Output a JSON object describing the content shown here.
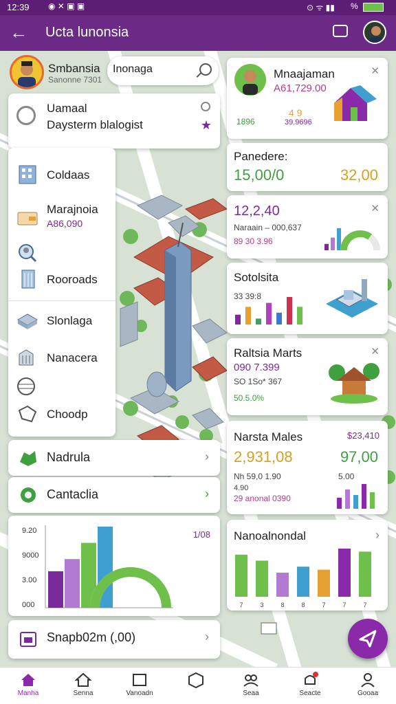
{
  "status_bar": {
    "time": "12:39",
    "battery": "%"
  },
  "app_bar": {
    "title": "Ucta lunonsia"
  },
  "profile": {
    "name": "Smbansia",
    "subtitle": "Sanonne 7301"
  },
  "search": {
    "value": "Inonaga"
  },
  "menu_card": {
    "title": "Uamaal",
    "subtitle": "Daysterm blalogist"
  },
  "list": [
    {
      "label": "Coldaas",
      "icon": "building-icon"
    },
    {
      "label": "Marajnoia",
      "value": "A86,090",
      "icon": "wallet-icon"
    },
    {
      "label": "",
      "icon": "search-person-icon"
    },
    {
      "label": "Rooroads",
      "icon": "tower-icon"
    },
    {
      "label": "Slonlaga",
      "icon": "city-icon"
    },
    {
      "label": "Nanacera",
      "icon": "factory-icon"
    },
    {
      "label": "",
      "icon": "globe-icon"
    },
    {
      "label": "Choodp",
      "icon": "tag-icon"
    }
  ],
  "rows": [
    {
      "label": "Nadrula",
      "icon": "map-icon"
    },
    {
      "label": "Cantaclia",
      "icon": "leaf-icon"
    }
  ],
  "left_chart": {
    "y_ticks": [
      "9.20",
      "9000",
      "3.00",
      "000"
    ],
    "corner_label": "1/08",
    "chart_data": {
      "type": "bar",
      "y_ticks": [
        "9.20",
        "9000",
        "3.00",
        "000"
      ],
      "values": [
        45,
        60,
        80,
        100
      ],
      "colors": [
        "#7a2a9a",
        "#b27ad0",
        "#6fc04a",
        "#3fa0d0"
      ],
      "gauge": 0.5,
      "gauge_color": "#6fc04a"
    }
  },
  "bottom_row": {
    "label": "Snapb02m (,00)"
  },
  "right_cards": [
    {
      "title": "Mnaajaman",
      "value": "A61,729.00",
      "stat_a": "1896",
      "stat_b": "4 9",
      "stat_c": "39.9696"
    },
    {
      "title": "Panedere:",
      "value_a": "15,00/0",
      "value_b": "32,00"
    },
    {
      "title": "12,2,40",
      "line1": "Naraain – 000,637",
      "line2": "89 30 3.96",
      "chart_data": {
        "type": "bar",
        "values": [
          20,
          40,
          70
        ],
        "gauge": 0.7
      }
    },
    {
      "title": "Sotolsita",
      "value": "33 39:8",
      "chart_data": {
        "type": "bar",
        "values": [
          25,
          45,
          15,
          55,
          30,
          70,
          45
        ],
        "colors": [
          "#7a2a9a",
          "#e8a030",
          "#3fa060",
          "#b040c0",
          "#3a7ad0",
          "#d03050",
          "#6fc04a"
        ]
      }
    },
    {
      "title": "Raltsia Marts",
      "value": "090 7.399",
      "line1": "SO 1So* 367",
      "line2": "50.5.0%"
    },
    {
      "title": "Narsta Males",
      "badge": "$23,410",
      "value_a": "2,931,08",
      "value_b": "97,00",
      "line1": "Nh 59,0 1.90",
      "line2": "4.90",
      "line3": "29 anonal 0390",
      "stat": "5.00",
      "chart_data": {
        "type": "bar",
        "values": [
          40,
          70,
          50,
          90,
          60
        ]
      }
    },
    {
      "title": "Nanoalnondal",
      "chart_data": {
        "type": "bar",
        "categories": [
          "7",
          "3",
          "8",
          "8",
          "7",
          "7",
          "7"
        ],
        "values": [
          70,
          60,
          40,
          50,
          45,
          80,
          75
        ],
        "colors": [
          "#6fc04a",
          "#6fc04a",
          "#b27ad0",
          "#3fa0d0",
          "#e8a030",
          "#8a2aa8",
          "#6fc04a"
        ]
      }
    }
  ],
  "tabs": [
    {
      "label": "Manha",
      "icon": "home-icon",
      "active": true
    },
    {
      "label": "Senna",
      "icon": "house-icon"
    },
    {
      "label": "Vanoadn",
      "icon": "box-icon"
    },
    {
      "label": "",
      "icon": "cube-icon"
    },
    {
      "label": "Seaa",
      "icon": "group-icon"
    },
    {
      "label": "Seacte",
      "icon": "bell-icon"
    },
    {
      "label": "Gooaa",
      "icon": "person-icon"
    }
  ]
}
